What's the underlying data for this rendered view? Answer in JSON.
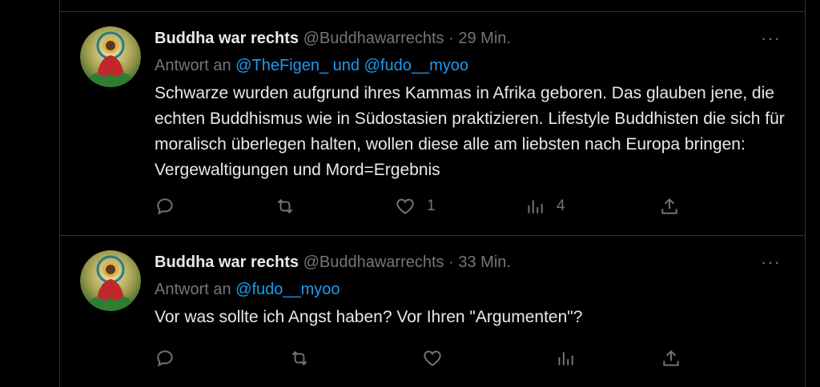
{
  "tweets": [
    {
      "name": "Buddha war rechts",
      "handle": "@Buddhawarrechts",
      "separator": "·",
      "time": "29 Min.",
      "reply_prefix": "Antwort an",
      "reply_mention1": "@TheFigen_",
      "reply_and": "und",
      "reply_mention2": "@fudo__myoo",
      "text": "Schwarze wurden aufgrund ihres Kammas in Afrika geboren. Das glauben jene, die echten Buddhismus wie in Südostasien praktizieren. Lifestyle Buddhisten die sich für moralisch überlegen halten, wollen diese alle am liebsten nach Europa bringen: Vergewaltigungen und Mord=Ergebnis",
      "likes": "1",
      "views": "4",
      "more": "···"
    },
    {
      "name": "Buddha war rechts",
      "handle": "@Buddhawarrechts",
      "separator": "·",
      "time": "33 Min.",
      "reply_prefix": "Antwort an",
      "reply_mention1": "@fudo__myoo",
      "text": "Vor was sollte ich Angst haben? Vor Ihren \"Argumenten\"?",
      "more": "···"
    }
  ],
  "icons": {
    "reply": "reply-icon",
    "retweet": "retweet-icon",
    "like": "heart-icon",
    "views": "views-icon",
    "share": "share-icon"
  },
  "colors": {
    "background": "#000000",
    "text": "#e7e9ea",
    "secondary": "#71767b",
    "accent": "#1d9bf0",
    "border": "#2f3336"
  }
}
